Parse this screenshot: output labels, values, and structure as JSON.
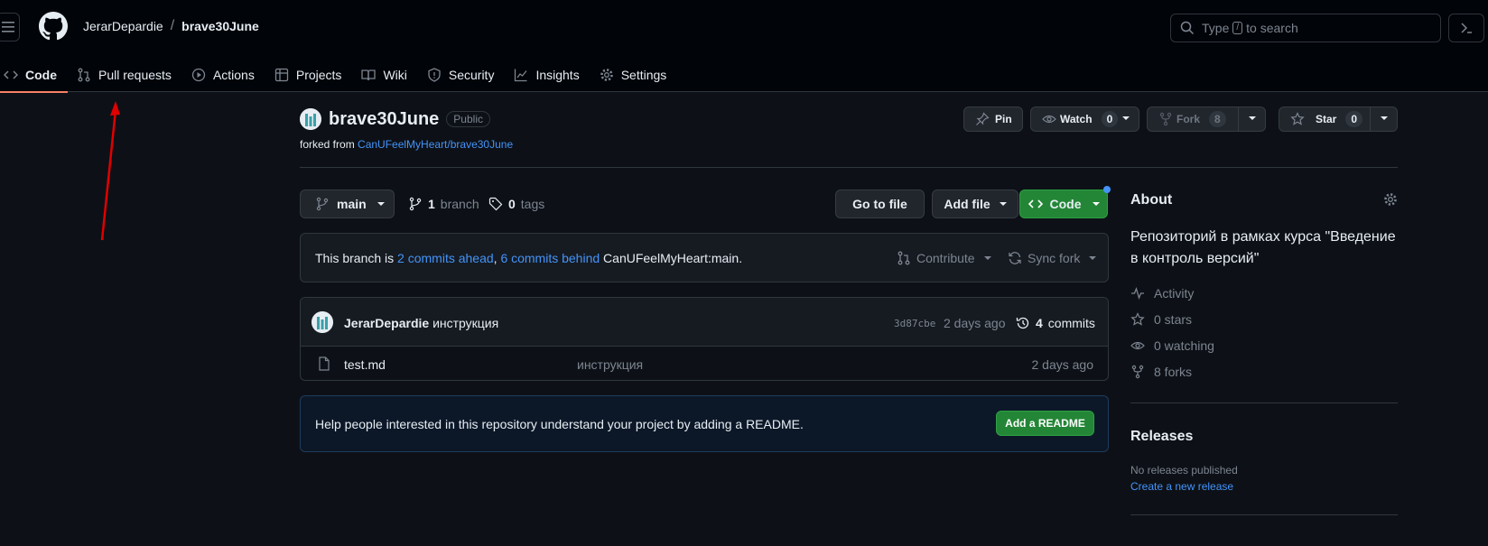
{
  "header": {
    "owner": "JerarDepardie",
    "separator": "/",
    "repo": "brave30June",
    "search_prefix": "Type",
    "search_key": "/",
    "search_suffix": "to search"
  },
  "tabs": [
    {
      "label": "Code",
      "icon": "code-icon"
    },
    {
      "label": "Pull requests",
      "icon": "pull-request-icon"
    },
    {
      "label": "Actions",
      "icon": "play-icon"
    },
    {
      "label": "Projects",
      "icon": "table-icon"
    },
    {
      "label": "Wiki",
      "icon": "book-icon"
    },
    {
      "label": "Security",
      "icon": "shield-icon"
    },
    {
      "label": "Insights",
      "icon": "graph-icon"
    },
    {
      "label": "Settings",
      "icon": "gear-icon"
    }
  ],
  "repo": {
    "name": "brave30June",
    "visibility": "Public",
    "forked_prefix": "forked from",
    "forked_from": "CanUFeelMyHeart/brave30June"
  },
  "actions": {
    "pin": "Pin",
    "watch": "Watch",
    "watch_count": "0",
    "fork": "Fork",
    "fork_count": "8",
    "star": "Star",
    "star_count": "0"
  },
  "filenav": {
    "branch": "main",
    "branch_count": "1",
    "branch_label": "branch",
    "tag_count": "0",
    "tag_label": "tags",
    "go_to_file": "Go to file",
    "add_file": "Add file",
    "code": "Code"
  },
  "compare": {
    "prefix": "This branch is",
    "ahead": "2 commits ahead",
    "comma": ",",
    "behind": "6 commits behind",
    "target": "CanUFeelMyHeart:main.",
    "contribute": "Contribute",
    "sync": "Sync fork"
  },
  "latest_commit": {
    "author": "JerarDepardie",
    "message": "инструкция",
    "sha": "3d87cbe",
    "ago": "2 days ago",
    "commit_count": "4",
    "commit_label": "commits"
  },
  "files": [
    {
      "name": "test.md",
      "message": "инструкция",
      "date": "2 days ago"
    }
  ],
  "readme": {
    "text": "Help people interested in this repository understand your project by adding a README.",
    "button": "Add a README"
  },
  "sidebar": {
    "about": "About",
    "description": "Репозиторий в рамках курса \"Введение в контроль версий\"",
    "activity": "Activity",
    "stars": "0 stars",
    "watching": "0 watching",
    "forks": "8 forks",
    "releases": "Releases",
    "no_releases": "No releases published",
    "create_release": "Create a new release"
  },
  "colors": {
    "accent": "#4493f8",
    "green": "#238636",
    "tab_underline": "#f78166",
    "annotation": "#e00000"
  }
}
